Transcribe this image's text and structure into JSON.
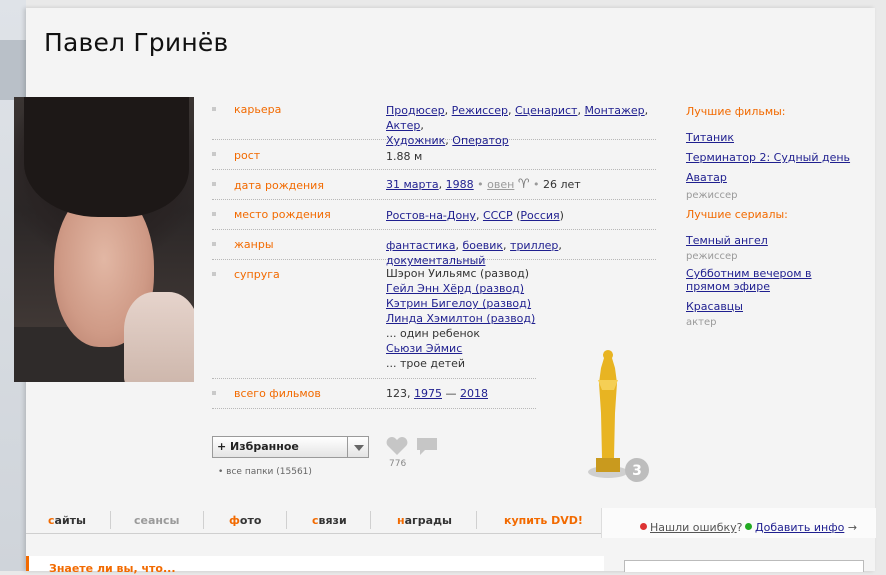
{
  "title": "Павел Гринёв",
  "info": [
    {
      "label": "карьера",
      "key": "career"
    },
    {
      "label": "рост",
      "key": "height"
    },
    {
      "label": "дата рождения",
      "key": "birth"
    },
    {
      "label": "место рождения",
      "key": "place"
    },
    {
      "label": "жанры",
      "key": "genres"
    },
    {
      "label": "супруга",
      "key": "spouse"
    },
    {
      "label": "всего фильмов",
      "key": "total"
    }
  ],
  "career": [
    "Продюсер",
    "Режиссер",
    "Сценарист",
    "Монтажер",
    "Актер",
    "Художник",
    "Оператор"
  ],
  "height": "1.88 м",
  "birth": {
    "day": "31 марта",
    "year": "1988",
    "sign": "овен",
    "symbol": "♈",
    "age": "26 лет"
  },
  "place": {
    "city": "Ростов-на-Дону",
    "country": "СССР",
    "now": "Россия"
  },
  "genres": [
    "фантастика",
    "боевик",
    "триллер",
    "документальный"
  ],
  "spouse": {
    "s1": "Шэрон Уильямс (развод)",
    "s2": "Гейл Энн Хёрд (развод)",
    "s3": "Кэтрин Бигелоу (развод)",
    "s4": "Линда Хэмилтон (развод)",
    "c1": "... один ребенок",
    "s5": "Сьюзи Эймис",
    "c2": "... трое детей"
  },
  "total": {
    "count": "123,",
    "from": "1975",
    "dash": "—",
    "to": "2018"
  },
  "best_films": {
    "heading": "Лучшие фильмы:",
    "items": [
      "Титаник",
      "Терминатор 2: Судный день",
      "Аватар"
    ],
    "role": "режиссер"
  },
  "best_series": {
    "heading": "Лучшие сериалы:",
    "items": [
      "Темный ангел",
      "Субботним вечером в прямом эфире",
      "Красавцы"
    ],
    "role1": "режиссер",
    "role2": "актер"
  },
  "favorites": {
    "label": "+ Избранное",
    "folders": "• все папки (15561)",
    "likes": "776"
  },
  "oscar_count": "3",
  "tabs": [
    {
      "first": "с",
      "rest": "айты"
    },
    {
      "full": "сеансы"
    },
    {
      "first": "ф",
      "rest": "ото"
    },
    {
      "first": "с",
      "rest": "вязи"
    },
    {
      "first": "н",
      "rest": "аграды"
    },
    {
      "first": "ку",
      "rest": "пить DVD!"
    }
  ],
  "error_link": "Нашли ошибку",
  "error_q": "?",
  "add_info": "Добавить инфо",
  "add_arrow": "→",
  "did_you_know": "Знаете ли вы, что...",
  "colors": {
    "accent": "#f26a00",
    "link": "#1f1f8f"
  }
}
